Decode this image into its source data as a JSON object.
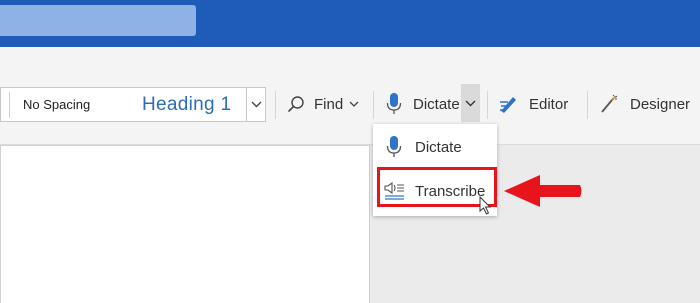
{
  "colors": {
    "title_bar": "#1f5bb8",
    "search_box": "#8fb2e6",
    "accent_blue": "#2e6db4",
    "highlight_red": "#e8141c"
  },
  "styles_gallery": {
    "items": [
      {
        "label": "No Spacing"
      },
      {
        "label": "Heading 1"
      }
    ]
  },
  "ribbon": {
    "find": {
      "label": "Find",
      "icon": "search-icon"
    },
    "dictate": {
      "label": "Dictate",
      "icon": "microphone-icon"
    },
    "editor": {
      "label": "Editor",
      "icon": "editor-pen-icon"
    },
    "designer": {
      "label": "Designer",
      "icon": "magic-wand-icon"
    }
  },
  "dictate_menu": {
    "items": [
      {
        "label": "Dictate",
        "icon": "microphone-icon"
      },
      {
        "label": "Transcribe",
        "icon": "transcribe-icon",
        "highlighted": true
      }
    ]
  },
  "annotation": {
    "pointer": "red-arrow-icon"
  }
}
